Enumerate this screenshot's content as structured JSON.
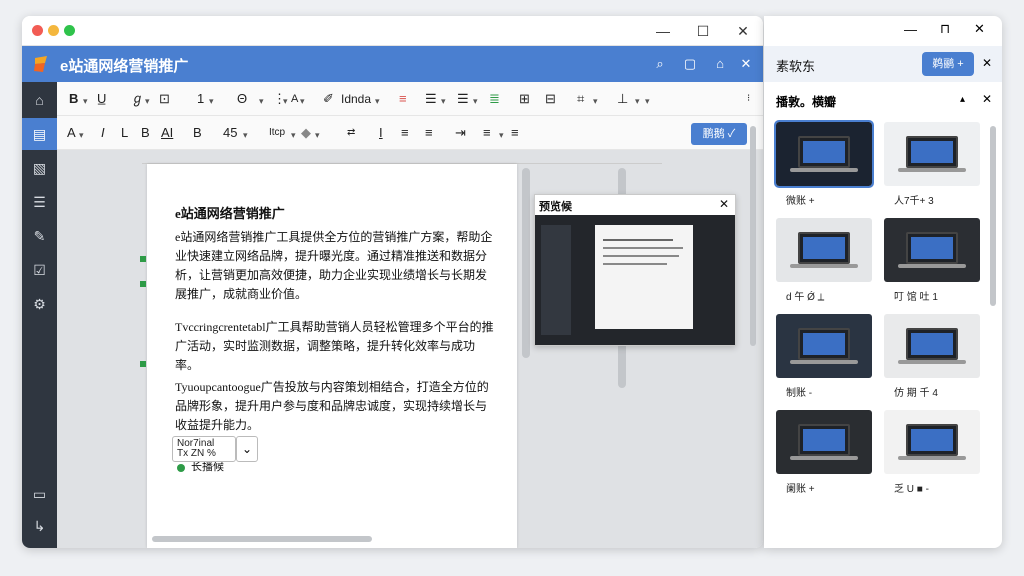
{
  "window": {
    "app_title": "e站通网络营销推广",
    "controls": {
      "minimize": "—",
      "maximize": "☐",
      "close": "✕"
    }
  },
  "appbar_icons": [
    "search-icon",
    "doc-icon",
    "box-icon",
    "close-icon"
  ],
  "toolbar1": {
    "bold": "B",
    "italic_glyph": "ℊ",
    "border": "⊡",
    "spacing": "1",
    "circle": "Θ",
    "font_color": "A",
    "font_name": "Idnda",
    "chevron": "▾"
  },
  "toolbar2": {
    "font_a": "A",
    "italic": "I",
    "l": "L",
    "ai": "AI",
    "b": "B",
    "size": "45",
    "font_style": "Itcp",
    "button": "鹏鹅 ✓"
  },
  "document": {
    "heading": "e站通网络营销推广",
    "para1": "e站通网络营销推广工具提供全方位的营销推广方案，帮助企业快速建立网络品牌，提升曝光度。通过精准推送和数据分析，让营销更加高效便捷，助力企业实现业绩增长与长期发展推广，成就商业价值。",
    "para2": "Tvccringcrentetabl广工具帮助营销人员轻松管理多个平台的推广活动，实时监测数据，调整策略，提升转化效率与成功率。",
    "para3": "Tyuoupcantoogue广告投放与内容策划相结合，打造全方位的品牌形象，提升用户参与度和品牌忠诚度，实现持续增长与收益提升能力。",
    "style_select": "Nor7inal\nTx ZN %",
    "status": "长播候"
  },
  "popup": {
    "title": "预览候",
    "close": "✕"
  },
  "panel": {
    "title": "素软东",
    "button": "鹈鹂 +",
    "section": "播敦。横瓣",
    "thumbs": [
      {
        "label": "微账 +",
        "bg": "#1b2330"
      },
      {
        "label": "人7千+ 3",
        "bg": "#eef0f2"
      },
      {
        "label": "d 午 Ǿ ⟂",
        "bg": "#e4e6e8"
      },
      {
        "label": "叮 馆 吐 1",
        "bg": "#2b2e33"
      },
      {
        "label": "制账 -",
        "bg": "#2a3442"
      },
      {
        "label": "仿 期 千 4",
        "bg": "#e9eaeb"
      },
      {
        "label": "阑账 +",
        "bg": "#2a2d31"
      },
      {
        "label": "乏 U ■ -",
        "bg": "#f2f2f2"
      }
    ]
  },
  "colors": {
    "accent": "#4a7fd0",
    "sidebar": "#2f3640",
    "green": "#2e9b47"
  }
}
